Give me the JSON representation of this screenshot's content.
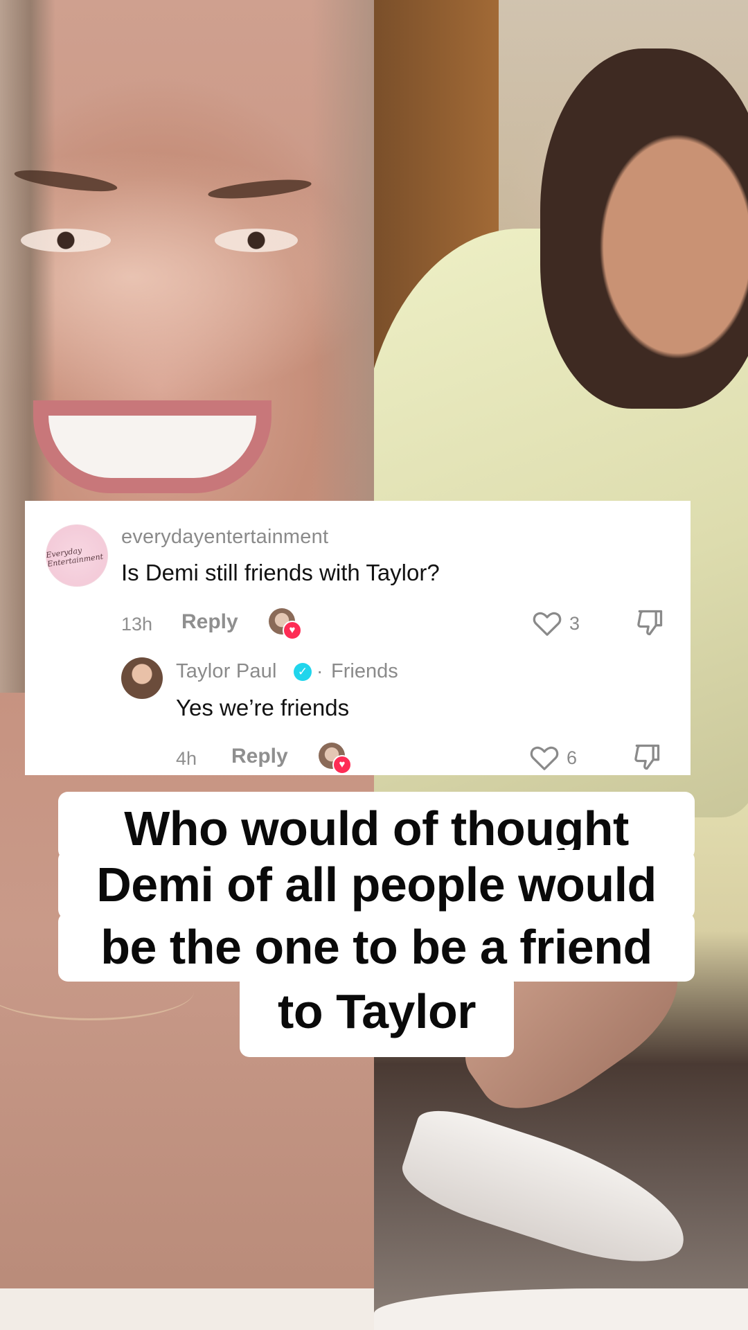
{
  "comment": {
    "username": "everydayentertainment",
    "avatar_text": "Everyday Entertainment",
    "text": "Is Demi still friends with Taylor?",
    "time": "13h",
    "reply_label": "Reply",
    "like_count": "3"
  },
  "reply": {
    "username": "Taylor Paul",
    "separator": "·",
    "relation": "Friends",
    "text": "Yes we’re friends",
    "time": "4h",
    "reply_label": "Reply",
    "like_count": "6"
  },
  "caption": {
    "lines": [
      "Who would of thought",
      "Demi of all people would",
      "be the one to be a friend",
      "to Taylor"
    ]
  },
  "colors": {
    "heart_badge": "#fe2c55",
    "verified": "#20d5ec",
    "muted_text": "#8a8a8a"
  },
  "icons": [
    "heart-outline-icon",
    "thumbs-down-icon",
    "verified-badge-icon",
    "heart-badge-icon"
  ]
}
